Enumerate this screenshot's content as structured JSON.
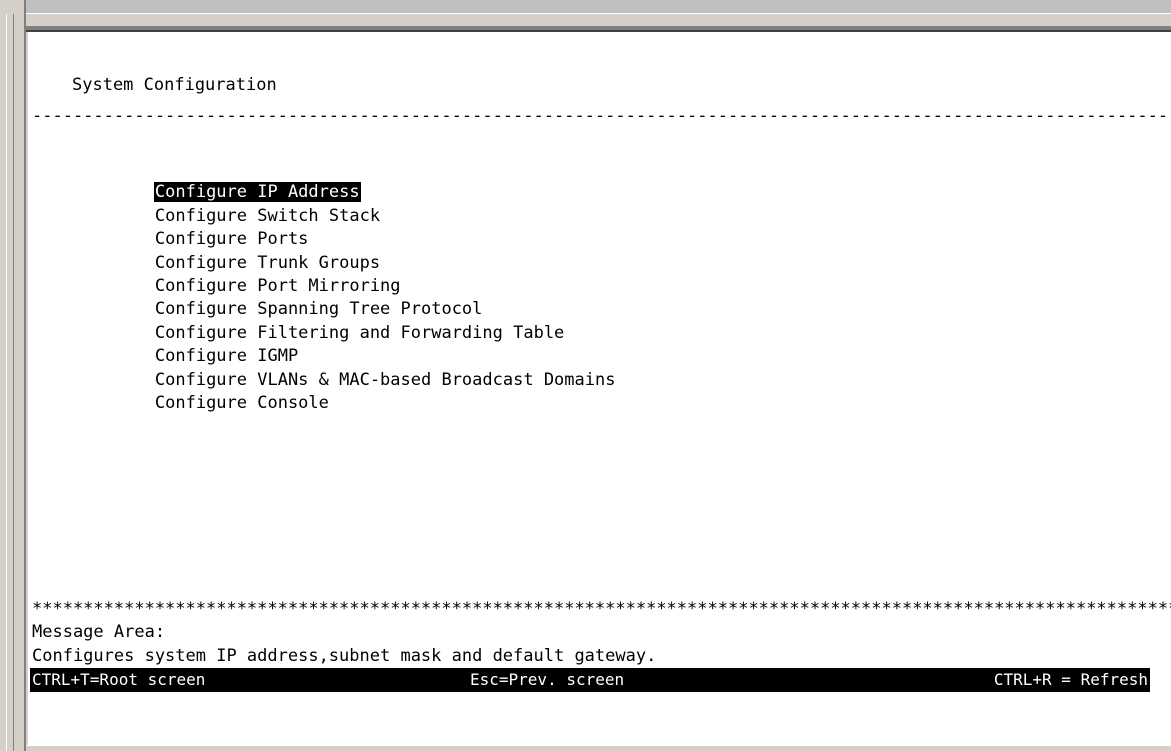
{
  "screen": {
    "title": "System Configuration",
    "separator": "----------------------------------------------------------------------------------------------------------------"
  },
  "menu": {
    "items": [
      {
        "label": "Configure IP Address",
        "selected": true
      },
      {
        "label": "Configure Switch Stack",
        "selected": false
      },
      {
        "label": "Configure Ports",
        "selected": false
      },
      {
        "label": "Configure Trunk Groups",
        "selected": false
      },
      {
        "label": "Configure Port Mirroring",
        "selected": false
      },
      {
        "label": "Configure Spanning Tree Protocol",
        "selected": false
      },
      {
        "label": "Configure Filtering and Forwarding Table",
        "selected": false
      },
      {
        "label": "Configure IGMP",
        "selected": false
      },
      {
        "label": "Configure VLANs & MAC-based Broadcast Domains",
        "selected": false
      },
      {
        "label": "Configure Console",
        "selected": false
      }
    ]
  },
  "message_area": {
    "divider": "****************************************************************************************************************",
    "header": "Message Area:",
    "text": "Configures system IP address,subnet mask and default gateway."
  },
  "status_bar": {
    "root": "CTRL+T=Root screen",
    "prev": "Esc=Prev. screen",
    "refresh": "CTRL+R = Refresh"
  },
  "colors": {
    "background": "#ffffff",
    "text": "#000000",
    "highlight_bg": "#000000",
    "highlight_fg": "#ffffff",
    "frame": "#d4d0c8"
  }
}
